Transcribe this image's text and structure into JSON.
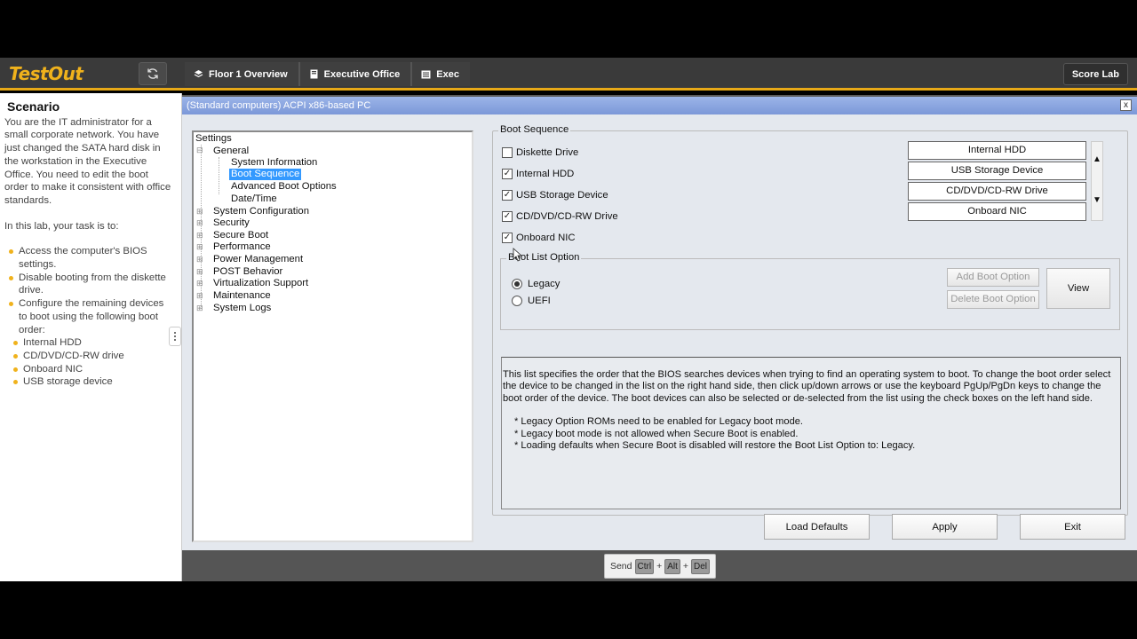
{
  "header": {
    "logo": "TestOut",
    "breadcrumbs": [
      {
        "label": "Floor 1 Overview",
        "icon": "layers-icon"
      },
      {
        "label": "Executive Office",
        "icon": "computer-icon"
      },
      {
        "label": "Exec",
        "icon": "rack-icon"
      }
    ],
    "score_label": "Score Lab"
  },
  "scenario": {
    "title": "Scenario",
    "intro": "You are the IT administrator for a small corporate network. You have just changed the SATA hard disk in the workstation in the Executive Office. You need to edit the boot order to make it consistent with office standards.",
    "task_intro": "In this lab, your task is to:",
    "tasks": [
      "Access the computer's BIOS settings.",
      "Disable booting from the diskette drive.",
      "Configure the remaining devices to boot using the following boot order:"
    ],
    "boot_order": [
      "Internal HDD",
      "CD/DVD/CD-RW drive",
      "Onboard NIC",
      "USB storage device"
    ]
  },
  "window": {
    "title": "(Standard computers) ACPI x86-based PC",
    "close": "x"
  },
  "tree": {
    "root": "Settings",
    "general": "General",
    "general_children": [
      "System Information",
      "Boot Sequence",
      "Advanced Boot Options",
      "Date/Time"
    ],
    "selected": "Boot Sequence",
    "groups": [
      "System Configuration",
      "Security",
      "Secure Boot",
      "Performance",
      "Power Management",
      "POST Behavior",
      "Virtualization Support",
      "Maintenance",
      "System Logs"
    ]
  },
  "boot_sequence": {
    "legend": "Boot Sequence",
    "devices": [
      {
        "label": "Diskette Drive",
        "checked": false
      },
      {
        "label": "Internal HDD",
        "checked": true
      },
      {
        "label": "USB Storage Device",
        "checked": true
      },
      {
        "label": "CD/DVD/CD-RW Drive",
        "checked": true
      },
      {
        "label": "Onboard NIC",
        "checked": true
      }
    ],
    "order": [
      "Internal HDD",
      "USB Storage Device",
      "CD/DVD/CD-RW Drive",
      "Onboard NIC"
    ],
    "arrow_up": "▲",
    "arrow_down": "▼"
  },
  "boot_list": {
    "legend": "Boot List Option",
    "options": [
      {
        "label": "Legacy",
        "selected": true
      },
      {
        "label": "UEFI",
        "selected": false
      }
    ],
    "add_label": "Add Boot Option",
    "delete_label": "Delete Boot Option",
    "view_label": "View"
  },
  "info": {
    "text": "This list specifies the order that the BIOS searches devices when trying to find an operating system to boot. To change the boot order select the device to be changed in the list on the right hand side, then click up/down arrows or use the keyboard PgUp/PgDn keys to change the boot order of the device. The boot devices can also be selected or de-selected from the list using the check boxes on the left hand side.",
    "notes": [
      "* Legacy Option ROMs need to be enabled for Legacy boot mode.",
      "* Legacy boot mode is not allowed when Secure Boot is enabled.",
      "* Loading defaults when Secure Boot is disabled will restore the Boot List Option to: Legacy."
    ]
  },
  "actions": {
    "load_defaults": "Load Defaults",
    "apply": "Apply",
    "exit": "Exit"
  },
  "send_keys": {
    "label": "Send",
    "keys": [
      "Ctrl",
      "Alt",
      "Del"
    ],
    "plus": "+"
  }
}
